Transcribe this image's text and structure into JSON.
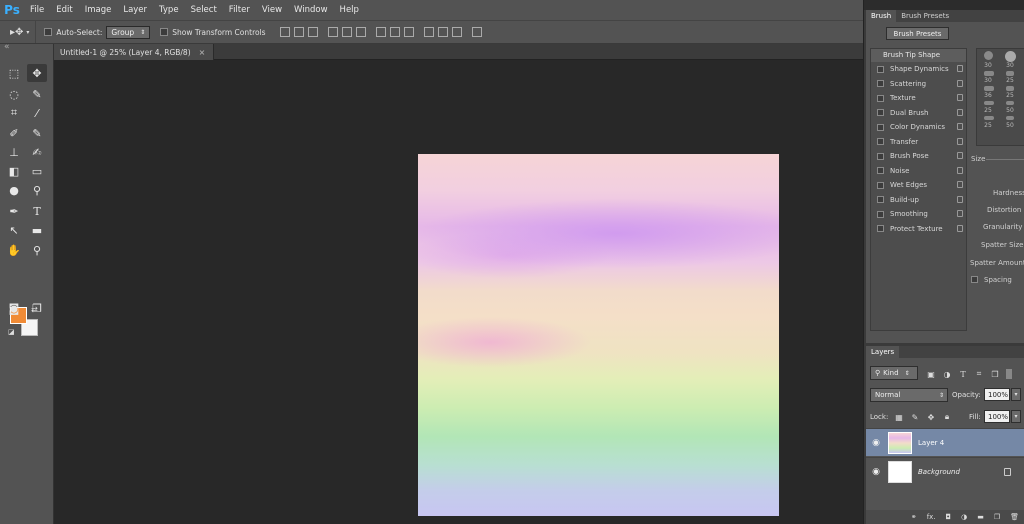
{
  "app": {
    "logo": "Ps"
  },
  "menu": [
    "File",
    "Edit",
    "Image",
    "Layer",
    "Type",
    "Select",
    "Filter",
    "View",
    "Window",
    "Help"
  ],
  "options": {
    "auto_select_label": "Auto-Select:",
    "auto_select_value": "Group",
    "show_transform_label": "Show Transform Controls"
  },
  "document": {
    "tab_title": "Untitled-1 @ 25% (Layer 4, RGB/8)",
    "tab_close": "×"
  },
  "colors": {
    "foreground": "#f08b36",
    "background": "#f5f5f5",
    "selected_layer": "#7588a6"
  },
  "brush_panel": {
    "tabs": [
      "Brush",
      "Brush Presets"
    ],
    "presets_button": "Brush Presets",
    "tip_shape_header": "Brush Tip Shape",
    "options": [
      "Shape Dynamics",
      "Scattering",
      "Texture",
      "Dual Brush",
      "Color Dynamics",
      "Transfer",
      "Brush Pose",
      "Noise",
      "Wet Edges",
      "Build-up",
      "Smoothing",
      "Protect Texture"
    ],
    "tip_sizes": [
      "30",
      "30",
      "30",
      "25",
      "36",
      "25",
      "25",
      "50",
      "25",
      "50"
    ],
    "size_label": "Size",
    "hardness_label": "Hardness",
    "distortion_label": "Distortion",
    "granularity_label": "Granularity",
    "spatter_size_label": "Spatter Size",
    "spatter_amount_label": "Spatter Amount",
    "spacing_label": "Spacing"
  },
  "layers_panel": {
    "tab": "Layers",
    "kind_label": "Kind",
    "blend_mode": "Normal",
    "opacity_label": "Opacity:",
    "opacity_value": "100%",
    "lock_label": "Lock:",
    "fill_label": "Fill:",
    "fill_value": "100%",
    "layers": [
      {
        "name": "Layer 4",
        "selected": true
      },
      {
        "name": "Background",
        "selected": false,
        "locked": true
      }
    ],
    "footer_icons": [
      "link-icon",
      "fx-icon",
      "mask-icon",
      "adjustment-icon",
      "folder-icon",
      "new-layer-icon",
      "trash-icon"
    ],
    "footer_fx": "fx."
  }
}
